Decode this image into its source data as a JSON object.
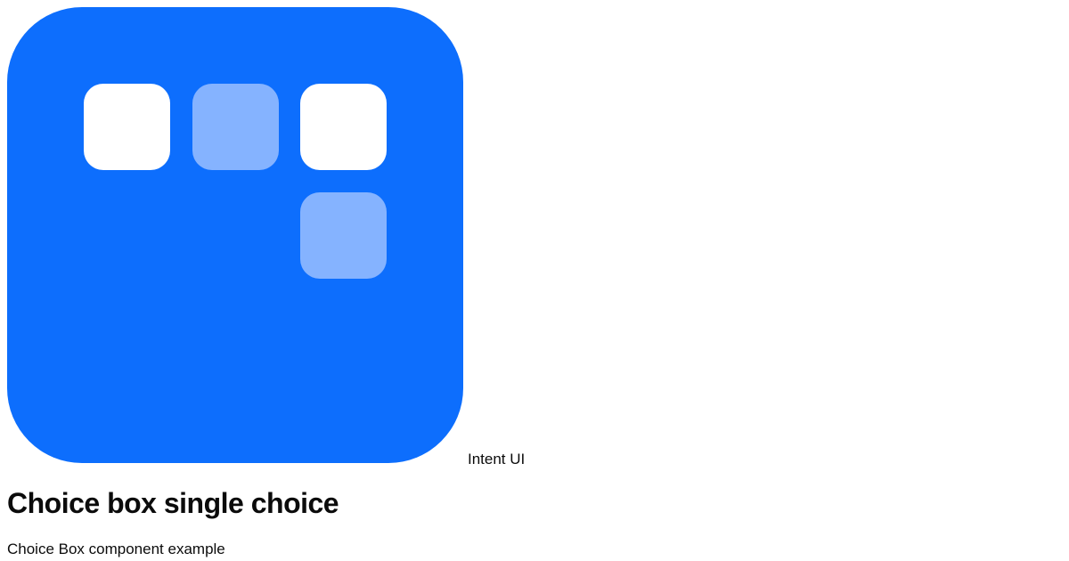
{
  "brand": {
    "name": "Intent UI",
    "logo_color": "#0d6efd",
    "tile_colors": {
      "solid": "#ffffff",
      "soft": "#85b3ff"
    }
  },
  "page": {
    "title": "Choice box single choice",
    "description": "Choice Box component example"
  }
}
